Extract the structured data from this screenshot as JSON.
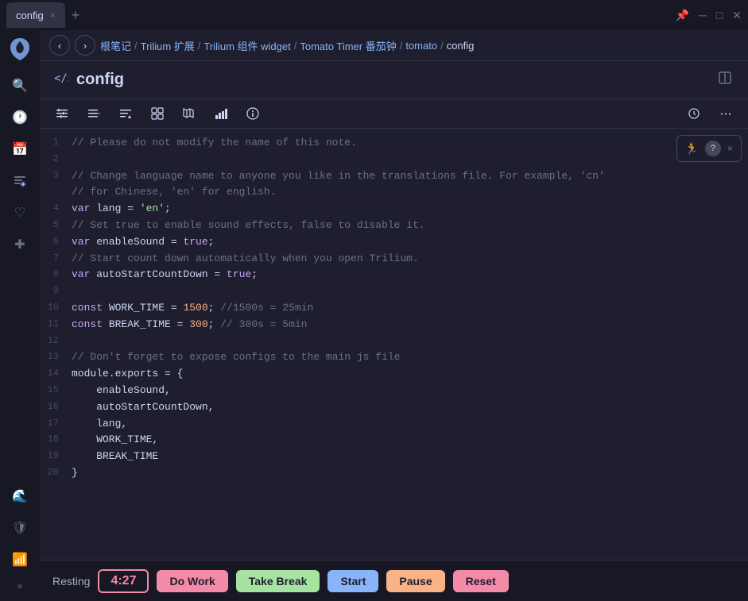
{
  "titlebar": {
    "tab_label": "config",
    "tab_close": "×",
    "tab_add": "+",
    "controls": [
      "pin-icon",
      "minimize-icon",
      "maximize-icon",
      "close-icon"
    ]
  },
  "breadcrumb": {
    "back_label": "‹",
    "forward_label": "›",
    "items": [
      {
        "label": "根笔记",
        "current": false
      },
      {
        "label": "Trilium 扩展",
        "current": false
      },
      {
        "label": "Trilium 组件 widget",
        "current": false
      },
      {
        "label": "Tomato Timer 番茄钟",
        "current": false
      },
      {
        "label": "tomato",
        "current": false
      },
      {
        "label": "config",
        "current": true
      }
    ],
    "separator": "/"
  },
  "note": {
    "type_icon": "{ }",
    "title": "config",
    "layout_icon": "⊡"
  },
  "toolbar": {
    "buttons": [
      "≡",
      "≡→",
      "≡+",
      "⊞",
      "🔖",
      "▦",
      "ℹ"
    ],
    "right_buttons": [
      "🕐",
      "⋯"
    ]
  },
  "code": {
    "lines": [
      {
        "num": 1,
        "content": "// Please do not modify the name of this note.",
        "type": "comment"
      },
      {
        "num": 2,
        "content": "",
        "type": "plain"
      },
      {
        "num": 3,
        "content": "// Change language name to anyone you like in the translations file. For example, 'cn'",
        "type": "comment"
      },
      {
        "num": 3,
        "content_cont": "// for Chinese, 'en' for english.",
        "type": "comment"
      },
      {
        "num": 4,
        "content": "var lang = 'en';",
        "type": "mixed"
      },
      {
        "num": 5,
        "content": "// Set true to enable sound effects, false to disable it.",
        "type": "comment"
      },
      {
        "num": 6,
        "content": "var enableSound = true;",
        "type": "mixed"
      },
      {
        "num": 7,
        "content": "// Start count down automatically when you open Trilium.",
        "type": "comment"
      },
      {
        "num": 8,
        "content": "var autoStartCountDown = true;",
        "type": "mixed"
      },
      {
        "num": 9,
        "content": "",
        "type": "plain"
      },
      {
        "num": 10,
        "content": "const WORK_TIME = 1500; //1500s = 25min",
        "type": "mixed"
      },
      {
        "num": 11,
        "content": "const BREAK_TIME = 300; // 300s = 5min",
        "type": "mixed"
      },
      {
        "num": 12,
        "content": "",
        "type": "plain"
      },
      {
        "num": 13,
        "content": "// Don't forget to expose configs to the main js file",
        "type": "comment"
      },
      {
        "num": 14,
        "content": "module.exports = {",
        "type": "plain"
      },
      {
        "num": 15,
        "content": "    enableSound,",
        "type": "plain"
      },
      {
        "num": 16,
        "content": "    autoStartCountDown,",
        "type": "plain"
      },
      {
        "num": 17,
        "content": "    lang,",
        "type": "plain"
      },
      {
        "num": 18,
        "content": "    WORK_TIME,",
        "type": "plain"
      },
      {
        "num": 19,
        "content": "    BREAK_TIME",
        "type": "plain"
      },
      {
        "num": 20,
        "content": "}",
        "type": "plain"
      }
    ]
  },
  "notification": {
    "icon": "🏃",
    "help_icon": "?",
    "close_icon": "×"
  },
  "statusbar": {
    "resting_label": "Resting",
    "timer_value": "4:27",
    "btn_dowork": "Do Work",
    "btn_takebreak": "Take Break",
    "btn_start": "Start",
    "btn_pause": "Pause",
    "btn_reset": "Reset"
  },
  "sidebar": {
    "logo": "🌿",
    "items": [
      {
        "icon": "🔍",
        "name": "search"
      },
      {
        "icon": "🕐",
        "name": "history"
      },
      {
        "icon": "📅",
        "name": "calendar"
      },
      {
        "icon": "➕",
        "name": "add-note"
      },
      {
        "icon": "♡",
        "name": "favorites"
      },
      {
        "icon": "➕",
        "name": "new"
      },
      {
        "icon": "🌊",
        "name": "jump"
      },
      {
        "icon": "🛡",
        "name": "protected"
      },
      {
        "icon": "📶",
        "name": "sync"
      }
    ],
    "expand_label": "»"
  },
  "colors": {
    "bg": "#1e1e2e",
    "sidebar_bg": "#181825",
    "border": "#313244",
    "comment": "#6c7086",
    "keyword": "#cba6f7",
    "string": "#a6e3a1",
    "number": "#fab387",
    "accent": "#89b4fa",
    "red": "#f38ba8",
    "green": "#a6e3a1",
    "orange": "#fab387"
  }
}
